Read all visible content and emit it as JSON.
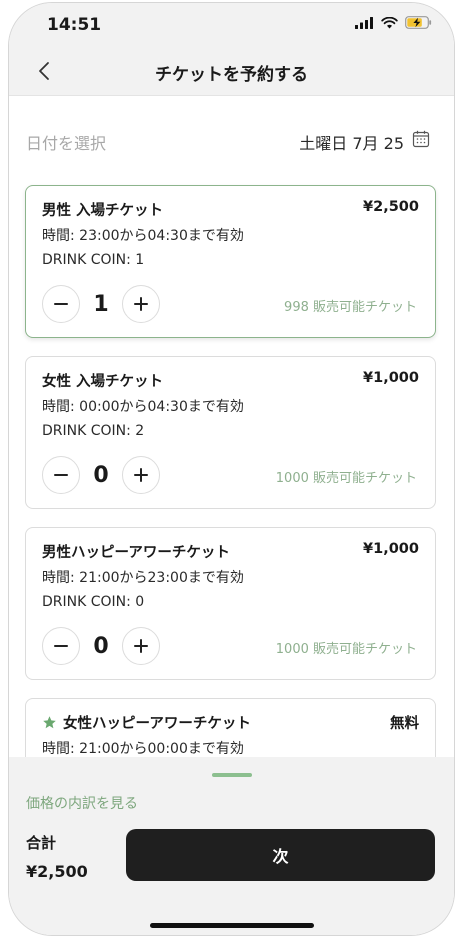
{
  "status_bar": {
    "time": "14:51"
  },
  "nav": {
    "title": "チケットを予約する"
  },
  "date_row": {
    "label": "日付を選択",
    "value": "土曜日 7月 25"
  },
  "tickets": [
    {
      "name": "男性 入場チケット",
      "price": "¥2,500",
      "time": "時間: 23:00から04:30まで有効",
      "coin": "DRINK COIN: 1",
      "qty": "1",
      "available": "998 販売可能チケット",
      "selected": true
    },
    {
      "name": "女性 入場チケット",
      "price": "¥1,000",
      "time": "時間: 00:00から04:30まで有効",
      "coin": "DRINK COIN: 2",
      "qty": "0",
      "available": "1000 販売可能チケット",
      "selected": false
    },
    {
      "name": "男性ハッピーアワーチケット",
      "price": "¥1,000",
      "time": "時間: 21:00から23:00まで有効",
      "coin": "DRINK COIN: 0",
      "qty": "0",
      "available": "1000 販売可能チケット",
      "selected": false
    },
    {
      "name": "女性ハッピーアワーチケット",
      "price": "無料",
      "time": "時間: 21:00から00:00まで有効",
      "icon": "star-icon",
      "selected": false
    }
  ],
  "footer": {
    "breakdown_link": "価格の内訳を見る",
    "total_label": "合計",
    "total_value": "¥2,500",
    "next_button": "次"
  },
  "colors": {
    "accent_green": "#8fb08f",
    "button_dark": "#1f1f1f",
    "star_green": "#6aa86f"
  }
}
